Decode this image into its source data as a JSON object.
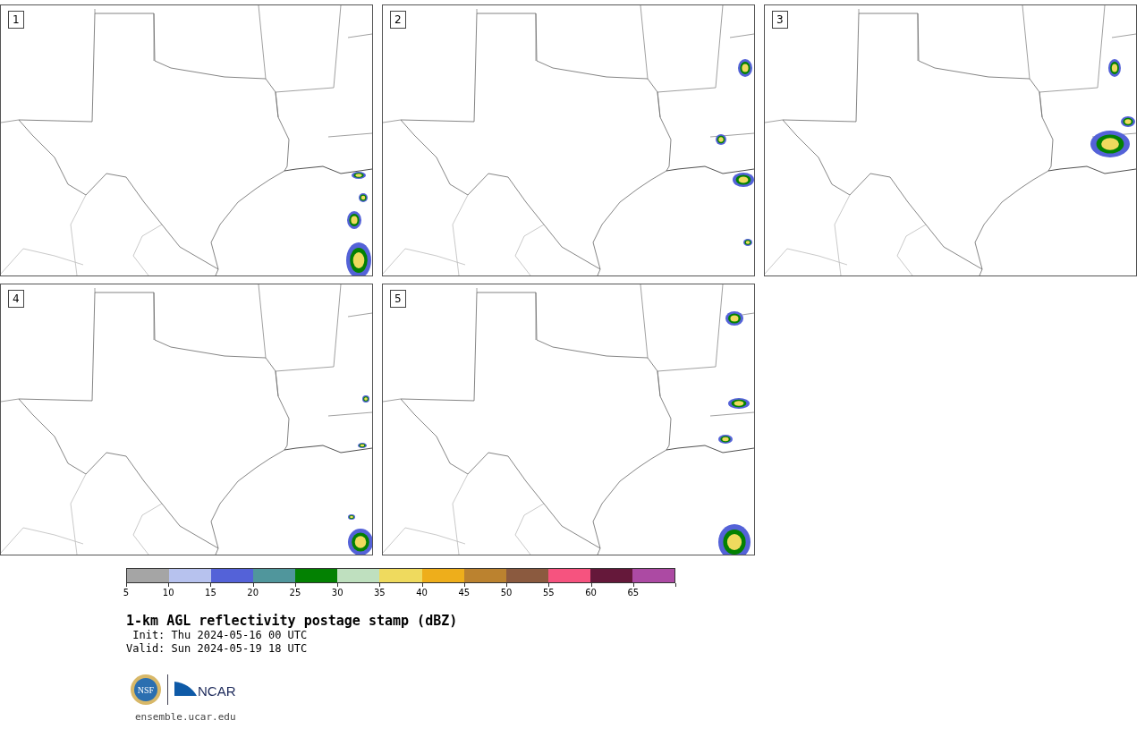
{
  "panels": [
    {
      "label": "1"
    },
    {
      "label": "2"
    },
    {
      "label": "3"
    },
    {
      "label": "4"
    },
    {
      "label": "5"
    }
  ],
  "colorbar": {
    "segments": [
      {
        "color": "#a5a5a5"
      },
      {
        "color": "#b7c2ee"
      },
      {
        "color": "#5462d8"
      },
      {
        "color": "#50969c"
      },
      {
        "color": "#038102"
      },
      {
        "color": "#bfe0bf"
      },
      {
        "color": "#efda5e"
      },
      {
        "color": "#eeae1b"
      },
      {
        "color": "#bb822f"
      },
      {
        "color": "#8b5a3f"
      },
      {
        "color": "#f6537f"
      },
      {
        "color": "#65183a"
      },
      {
        "color": "#ac4aa3"
      }
    ],
    "tick_labels": [
      "5",
      "10",
      "15",
      "20",
      "25",
      "30",
      "35",
      "40",
      "45",
      "50",
      "55",
      "60",
      "65"
    ]
  },
  "title": "1-km AGL reflectivity postage stamp (dBZ)",
  "init": " Init: Thu 2024-05-16 00 UTC",
  "valid": "Valid: Sun 2024-05-19 18 UTC",
  "logos": {
    "nsf_text": "NSF",
    "ncar_text": "NCAR"
  },
  "site": "ensemble.ucar.edu"
}
